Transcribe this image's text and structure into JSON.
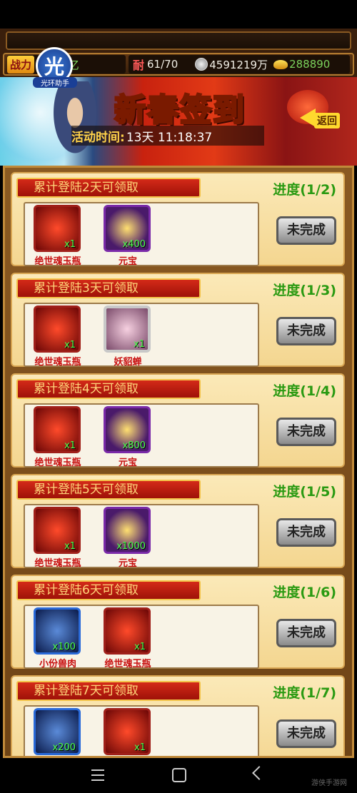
{
  "stats": {
    "power_label": "战力",
    "power_value": "1347亿",
    "stamina_label": "耐",
    "stamina_value": "61/70",
    "silver_value": "4591219万",
    "gold_value": "288890"
  },
  "banner": {
    "title": "新春签到",
    "return_label": "返回",
    "helper_char": "光",
    "helper_label": "光环助手",
    "time_label": "活动时间:",
    "time_value": "13天 11:18:37"
  },
  "rewards": [
    {
      "title": "累计登陆2天可领取",
      "progress": "进度(1/2)",
      "button": "未完成",
      "items": [
        {
          "name": "绝世魂玉瓶",
          "qty": "x1",
          "icon": "jade-bottle-icon"
        },
        {
          "name": "元宝",
          "qty": "x400",
          "icon": "gold-ingot-icon"
        }
      ]
    },
    {
      "title": "累计登陆3天可领取",
      "progress": "进度(1/3)",
      "button": "未完成",
      "items": [
        {
          "name": "绝世魂玉瓶",
          "qty": "x1",
          "icon": "jade-bottle-icon"
        },
        {
          "name": "妖貂蝉",
          "qty": "x1",
          "icon": "hero-portrait-icon"
        }
      ]
    },
    {
      "title": "累计登陆4天可领取",
      "progress": "进度(1/4)",
      "button": "未完成",
      "items": [
        {
          "name": "绝世魂玉瓶",
          "qty": "x1",
          "icon": "jade-bottle-icon"
        },
        {
          "name": "元宝",
          "qty": "x800",
          "icon": "gold-ingot-icon"
        }
      ]
    },
    {
      "title": "累计登陆5天可领取",
      "progress": "进度(1/5)",
      "button": "未完成",
      "items": [
        {
          "name": "绝世魂玉瓶",
          "qty": "x1",
          "icon": "jade-bottle-icon"
        },
        {
          "name": "元宝",
          "qty": "x1000",
          "icon": "gold-ingot-icon"
        }
      ]
    },
    {
      "title": "累计登陆6天可领取",
      "progress": "进度(1/6)",
      "button": "未完成",
      "items": [
        {
          "name": "小份兽肉",
          "qty": "x100",
          "icon": "meat-icon"
        },
        {
          "name": "绝世魂玉瓶",
          "qty": "x1",
          "icon": "jade-bottle-icon"
        }
      ]
    },
    {
      "title": "累计登陆7天可领取",
      "progress": "进度(1/7)",
      "button": "未完成",
      "items": [
        {
          "name": "",
          "qty": "x200",
          "icon": "meat-icon"
        },
        {
          "name": "",
          "qty": "x1",
          "icon": "jade-bottle-icon"
        }
      ]
    }
  ],
  "watermark": "游侠手游网",
  "colors": {
    "accent_gold": "#ffd24a",
    "progress_green": "#2a9a12",
    "ribbon_red": "#c81e12"
  }
}
